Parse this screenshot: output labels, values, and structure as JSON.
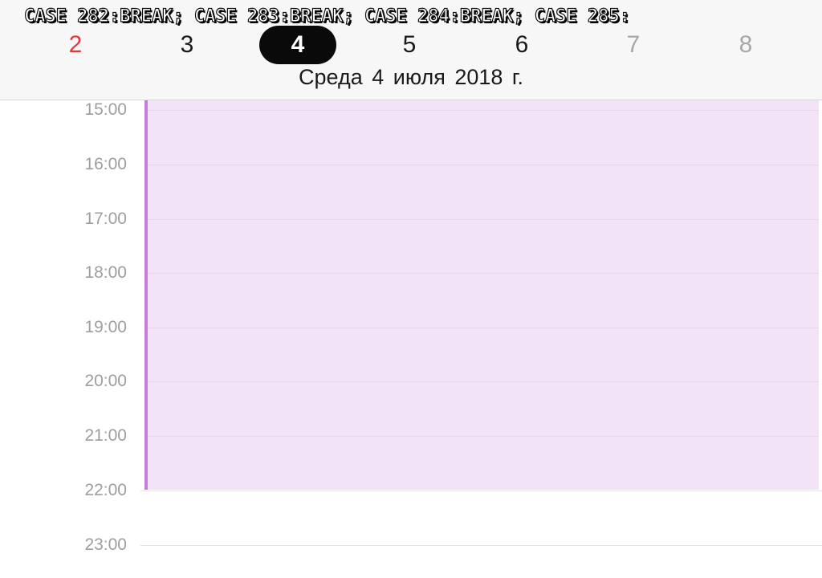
{
  "overlay_caption": "CASE 282:BREAK; CASE 283:BREAK; CASE 284:BREAK; CASE 285:",
  "week_days": [
    {
      "label": "2",
      "kind": "sunday"
    },
    {
      "label": "3",
      "kind": "normal"
    },
    {
      "label": "4",
      "kind": "selected"
    },
    {
      "label": "5",
      "kind": "normal"
    },
    {
      "label": "6",
      "kind": "normal"
    },
    {
      "label": "7",
      "kind": "weekend"
    },
    {
      "label": "8",
      "kind": "weekend"
    }
  ],
  "selected_date_title": "Среда  4 июля 2018 г.",
  "hours": [
    "15:00",
    "16:00",
    "17:00",
    "18:00",
    "19:00",
    "20:00",
    "21:00",
    "22:00",
    "23:00"
  ],
  "event": {
    "start": "15:00",
    "end": "22:00",
    "color": "#f3e3f7",
    "accent_color": "#c77dd9"
  },
  "colors": {
    "sunday": "#e53935",
    "selected_bg": "#0a0a0a",
    "hour_label": "#9e9e9e",
    "weekend": "#a8a8a8"
  }
}
